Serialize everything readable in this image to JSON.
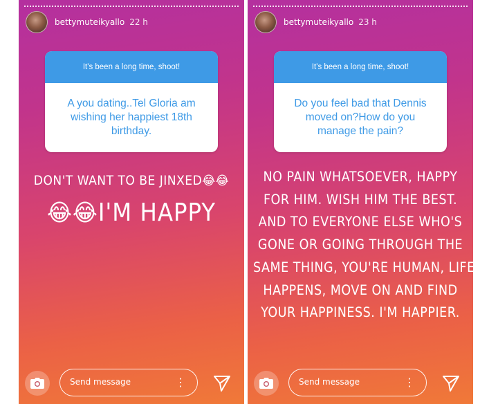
{
  "stories": [
    {
      "username": "bettymuteikyallo",
      "time": "22 h",
      "question_prompt": "It's been a long time, shoot!",
      "question": "A you dating..Tel Gloria am wishing  her happiest 18th birthday.",
      "answer_line_1": "DON'T WANT TO BE JINXED",
      "answer_line_1_emoji": "😂😂",
      "answer_line_2_emoji": "😂😂",
      "answer_line_2": "I'M HAPPY",
      "send_placeholder": "Send message"
    },
    {
      "username": "bettymuteikyallo",
      "time": "23 h",
      "question_prompt": "It's been a long time, shoot!",
      "question": "Do you feel bad that Dennis moved on?How do you manage the pain?",
      "answer_lines": [
        "NO PAIN WHATSOEVER, HAPPY",
        "FOR HIM. WISH HIM THE BEST.",
        "AND TO EVERYONE ELSE WHO'S",
        "GONE OR GOING THROUGH THE",
        "SAME THING, YOU'RE HUMAN, LIFE",
        "HAPPENS, MOVE ON AND FIND",
        "YOUR HAPPINESS. I'M HAPPIER."
      ],
      "send_placeholder": "Send message"
    }
  ],
  "icons": {
    "camera": "camera-icon",
    "options": "more-options-icon",
    "send": "send-icon"
  }
}
